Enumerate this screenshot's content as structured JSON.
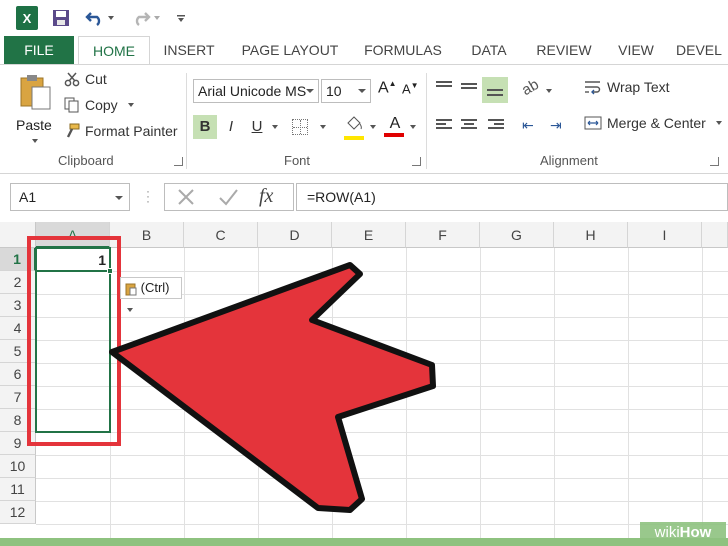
{
  "qat": {
    "excel_logo": "X",
    "icons": [
      "excel-logo-icon",
      "save-icon",
      "undo-icon",
      "redo-icon",
      "customize-qat-icon"
    ]
  },
  "tabs": [
    "FILE",
    "HOME",
    "INSERT",
    "PAGE LAYOUT",
    "FORMULAS",
    "DATA",
    "REVIEW",
    "VIEW",
    "DEVEL"
  ],
  "ribbon": {
    "clipboard": {
      "paste": "Paste",
      "cut": "Cut",
      "copy": "Copy",
      "format_painter": "Format Painter",
      "label": "Clipboard"
    },
    "font": {
      "name": "Arial Unicode MS",
      "size": "10",
      "bold": "B",
      "italic": "I",
      "underline": "U",
      "label": "Font"
    },
    "alignment": {
      "wrap_text": "Wrap Text",
      "merge_center": "Merge & Center",
      "label": "Alignment"
    }
  },
  "formula_bar": {
    "name_box": "A1",
    "fx": "fx",
    "formula": "=ROW(A1)"
  },
  "sheet": {
    "columns": [
      "A",
      "B",
      "C",
      "D",
      "E",
      "F",
      "G",
      "H",
      "I"
    ],
    "rows": [
      "1",
      "2",
      "3",
      "4",
      "5",
      "6",
      "7",
      "8",
      "9",
      "10",
      "11",
      "12"
    ],
    "a1_value": "1",
    "paste_options": "(Ctrl)"
  },
  "watermark": {
    "wiki": "wiki",
    "how": "How"
  },
  "colors": {
    "excel_green": "#217346",
    "arrow_red": "#e4343b",
    "highlight_yellow": "#ffe600",
    "font_red": "#e00000"
  }
}
